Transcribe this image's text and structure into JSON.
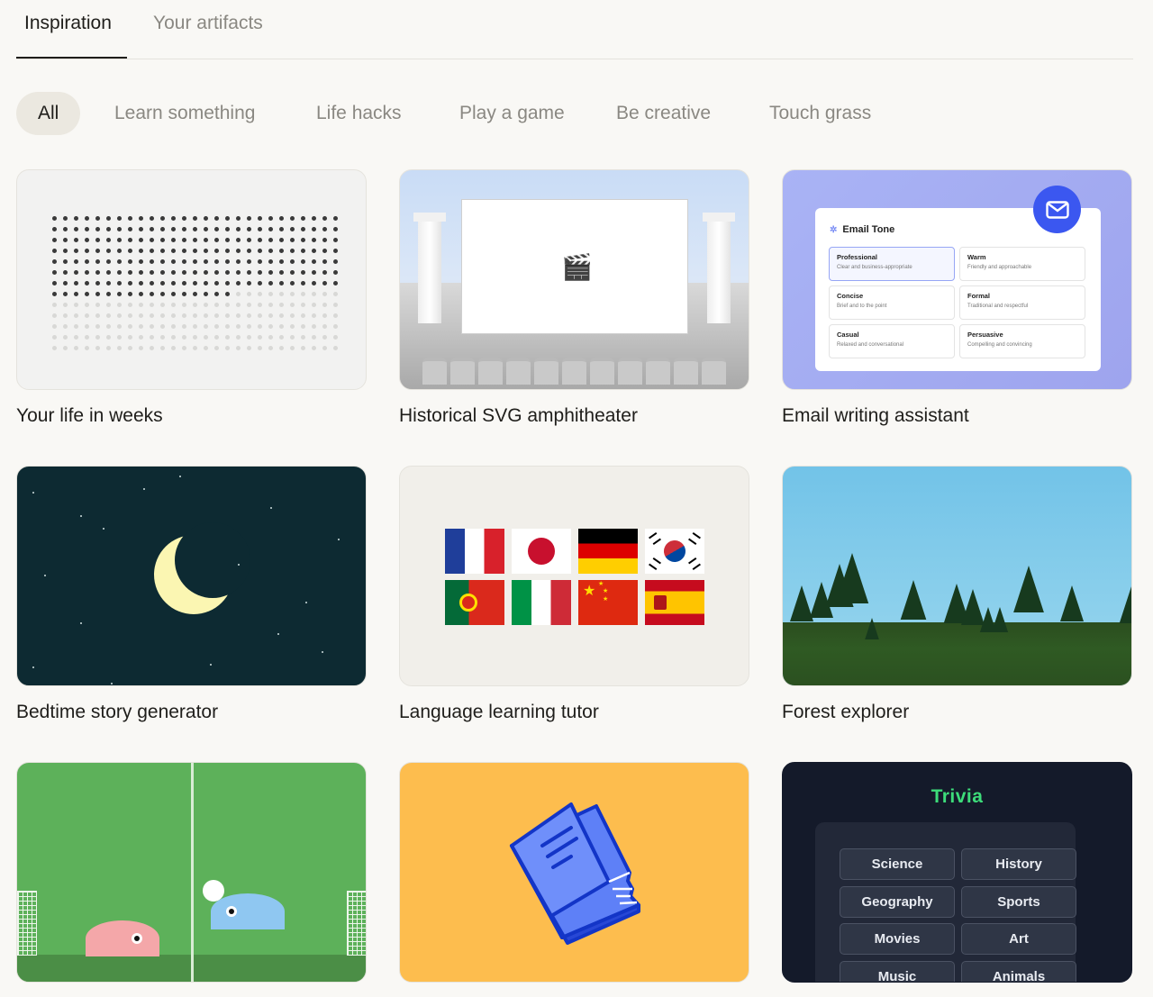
{
  "tabs": [
    {
      "label": "Inspiration",
      "active": true
    },
    {
      "label": "Your artifacts",
      "active": false
    }
  ],
  "filters": [
    {
      "label": "All",
      "active": true
    },
    {
      "label": "Learn something"
    },
    {
      "label": "Life hacks"
    },
    {
      "label": "Play a game"
    },
    {
      "label": "Be creative"
    },
    {
      "label": "Touch grass"
    }
  ],
  "cards": [
    {
      "title": "Your life in weeks"
    },
    {
      "title": "Historical SVG amphitheater",
      "screen_icon": "🎬"
    },
    {
      "title": "Email writing assistant",
      "email": {
        "heading": "Email Tone",
        "options": [
          {
            "name": "Professional",
            "desc": "Clear and business-appropriate"
          },
          {
            "name": "Warm",
            "desc": "Friendly and approachable"
          },
          {
            "name": "Concise",
            "desc": "Brief and to the point"
          },
          {
            "name": "Formal",
            "desc": "Traditional and respectful"
          },
          {
            "name": "Casual",
            "desc": "Relaxed and conversational"
          },
          {
            "name": "Persuasive",
            "desc": "Compelling and convincing"
          }
        ]
      }
    },
    {
      "title": "Bedtime story generator"
    },
    {
      "title": "Language learning tutor"
    },
    {
      "title": "Forest explorer"
    },
    {
      "title": ""
    },
    {
      "title": ""
    },
    {
      "title": "",
      "trivia": {
        "heading": "Trivia",
        "categories": [
          "Science",
          "History",
          "Geography",
          "Sports",
          "Movies",
          "Art",
          "Music",
          "Animals"
        ]
      }
    }
  ],
  "colors": {
    "accent_blue": "#3b57f0",
    "trivia_green": "#3ddc7a",
    "book_yellow": "#fdbd4e"
  }
}
